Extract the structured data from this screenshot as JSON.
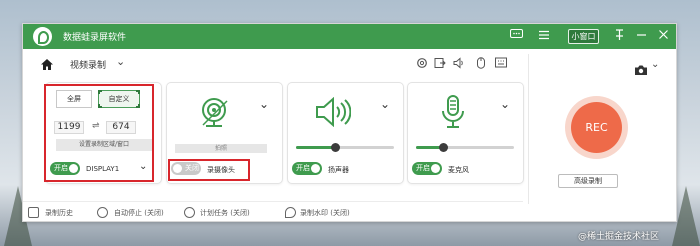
{
  "app": {
    "title": "数据蛙录屏软件"
  },
  "titlebar": {
    "mini_window_label": "小窗口",
    "icons": [
      "chat-icon",
      "menu-icon",
      "mini-window-button",
      "pin-icon",
      "minimize-icon",
      "close-icon"
    ]
  },
  "breadcrumb": {
    "label": "视频录制"
  },
  "region_card": {
    "fullscreen_label": "全屏",
    "custom_label": "自定义",
    "width": "1199",
    "height": "674",
    "set_area_label": "设置录制区域/窗口",
    "toggle_label": "开启",
    "display_value": "DISPLAY1"
  },
  "webcam_card": {
    "photo_label": "拍照",
    "toggle_label": "关闭",
    "device_label": "录摄像头"
  },
  "speaker_card": {
    "toggle_label": "开启",
    "device_label": "扬声器",
    "volume_level": 0.4
  },
  "mic_card": {
    "toggle_label": "开启",
    "device_label": "麦克风",
    "volume_level": 0.28
  },
  "rec": {
    "label": "REC",
    "advanced_label": "高级录制"
  },
  "bottombar": {
    "history": "录制历史",
    "auto_stop": "自动停止 (关闭)",
    "schedule": "计划任务 (关闭)",
    "watermark": "录制水印 (关闭)"
  },
  "overlay": {
    "watermark_text": "@稀土掘金技术社区"
  },
  "colors": {
    "brand_green": "#3f9b4e",
    "rec_orange": "#ee6a49",
    "highlight_red": "#d8262c"
  }
}
